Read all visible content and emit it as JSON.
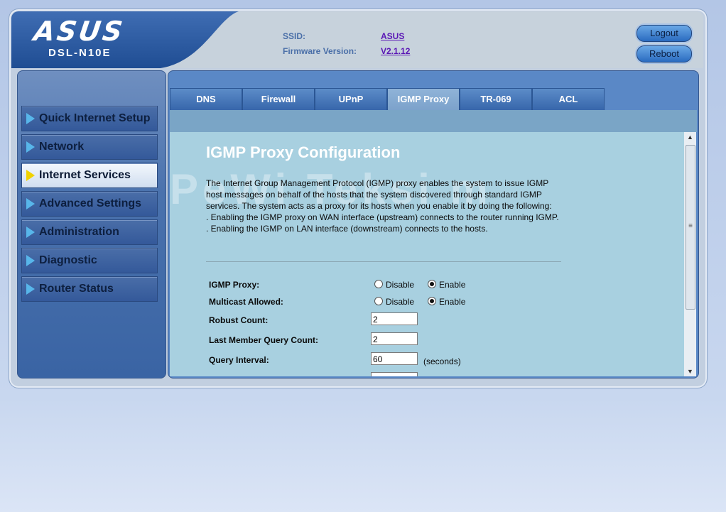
{
  "header": {
    "brand": "ASUS",
    "model": "DSL-N10E",
    "ssid_label": "SSID:",
    "ssid_value": "ASUS",
    "fw_label": "Firmware Version:",
    "fw_value": "V2.1.12",
    "logout_label": "Logout",
    "reboot_label": "Reboot"
  },
  "sidebar": {
    "items": [
      {
        "label": "Quick Internet Setup"
      },
      {
        "label": "Network"
      },
      {
        "label": "Internet Services"
      },
      {
        "label": "Advanced Settings"
      },
      {
        "label": "Administration"
      },
      {
        "label": "Diagnostic"
      },
      {
        "label": "Router Status"
      }
    ],
    "active_index": 2
  },
  "tabs": [
    {
      "label": "DNS"
    },
    {
      "label": "Firewall"
    },
    {
      "label": "UPnP"
    },
    {
      "label": "IGMP Proxy"
    },
    {
      "label": "TR-069"
    },
    {
      "label": "ACL"
    }
  ],
  "active_tab": "IGMP Proxy",
  "page": {
    "title": "IGMP Proxy Configuration",
    "description": [
      "The Internet Group Management Protocol (IGMP) proxy enables the system to issue IGMP host messages on behalf of the hosts that the system discovered through standard IGMP services. The system acts as a proxy for its hosts when you enable it by doing the following:",
      ". Enabling the IGMP proxy on WAN interface (upstream) connects to the router running IGMP.",
      ". Enabling the IGMP on LAN interface (downstream) connects to the hosts."
    ],
    "fields": {
      "igmp_proxy_label": "IGMP Proxy:",
      "multicast_label": "Multicast Allowed:",
      "disable_label": "Disable",
      "enable_label": "Enable",
      "robust_label": "Robust Count:",
      "robust_value": "2",
      "last_member_label": "Last Member Query Count:",
      "last_member_value": "2",
      "query_interval_label": "Query Interval:",
      "query_interval_value": "60",
      "seconds_unit": "(seconds)"
    },
    "watermark": "PeWi    Teksi m"
  },
  "colors": {
    "accent": "#3a64a4",
    "panel": "#a8d0e0",
    "active_arrow": "#f0d200",
    "arrow": "#58b6ea"
  }
}
